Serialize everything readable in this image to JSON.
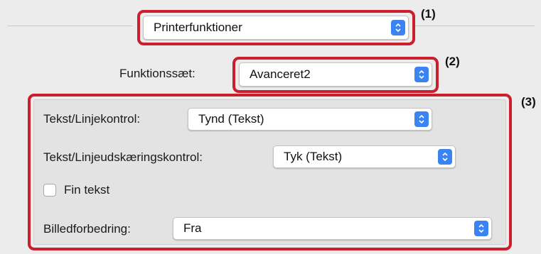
{
  "printer_functions": {
    "selected": "Printerfunktioner"
  },
  "feature_set": {
    "label": "Funktionssæt:",
    "selected": "Avanceret2"
  },
  "text_line_control": {
    "label": "Tekst/Linjekontrol:",
    "selected": "Tynd (Tekst)"
  },
  "text_line_edge_control": {
    "label": "Tekst/Linjeudskæringskontrol:",
    "selected": "Tyk (Tekst)"
  },
  "fine_text": {
    "label": "Fin tekst",
    "checked": false
  },
  "image_enhancement": {
    "label": "Billedforbedring:",
    "selected": "Fra"
  },
  "callouts": {
    "one": "(1)",
    "two": "(2)",
    "three": "(3)"
  },
  "colors": {
    "callout_border": "#cc1f2d",
    "stepper": "#3a83f3"
  }
}
